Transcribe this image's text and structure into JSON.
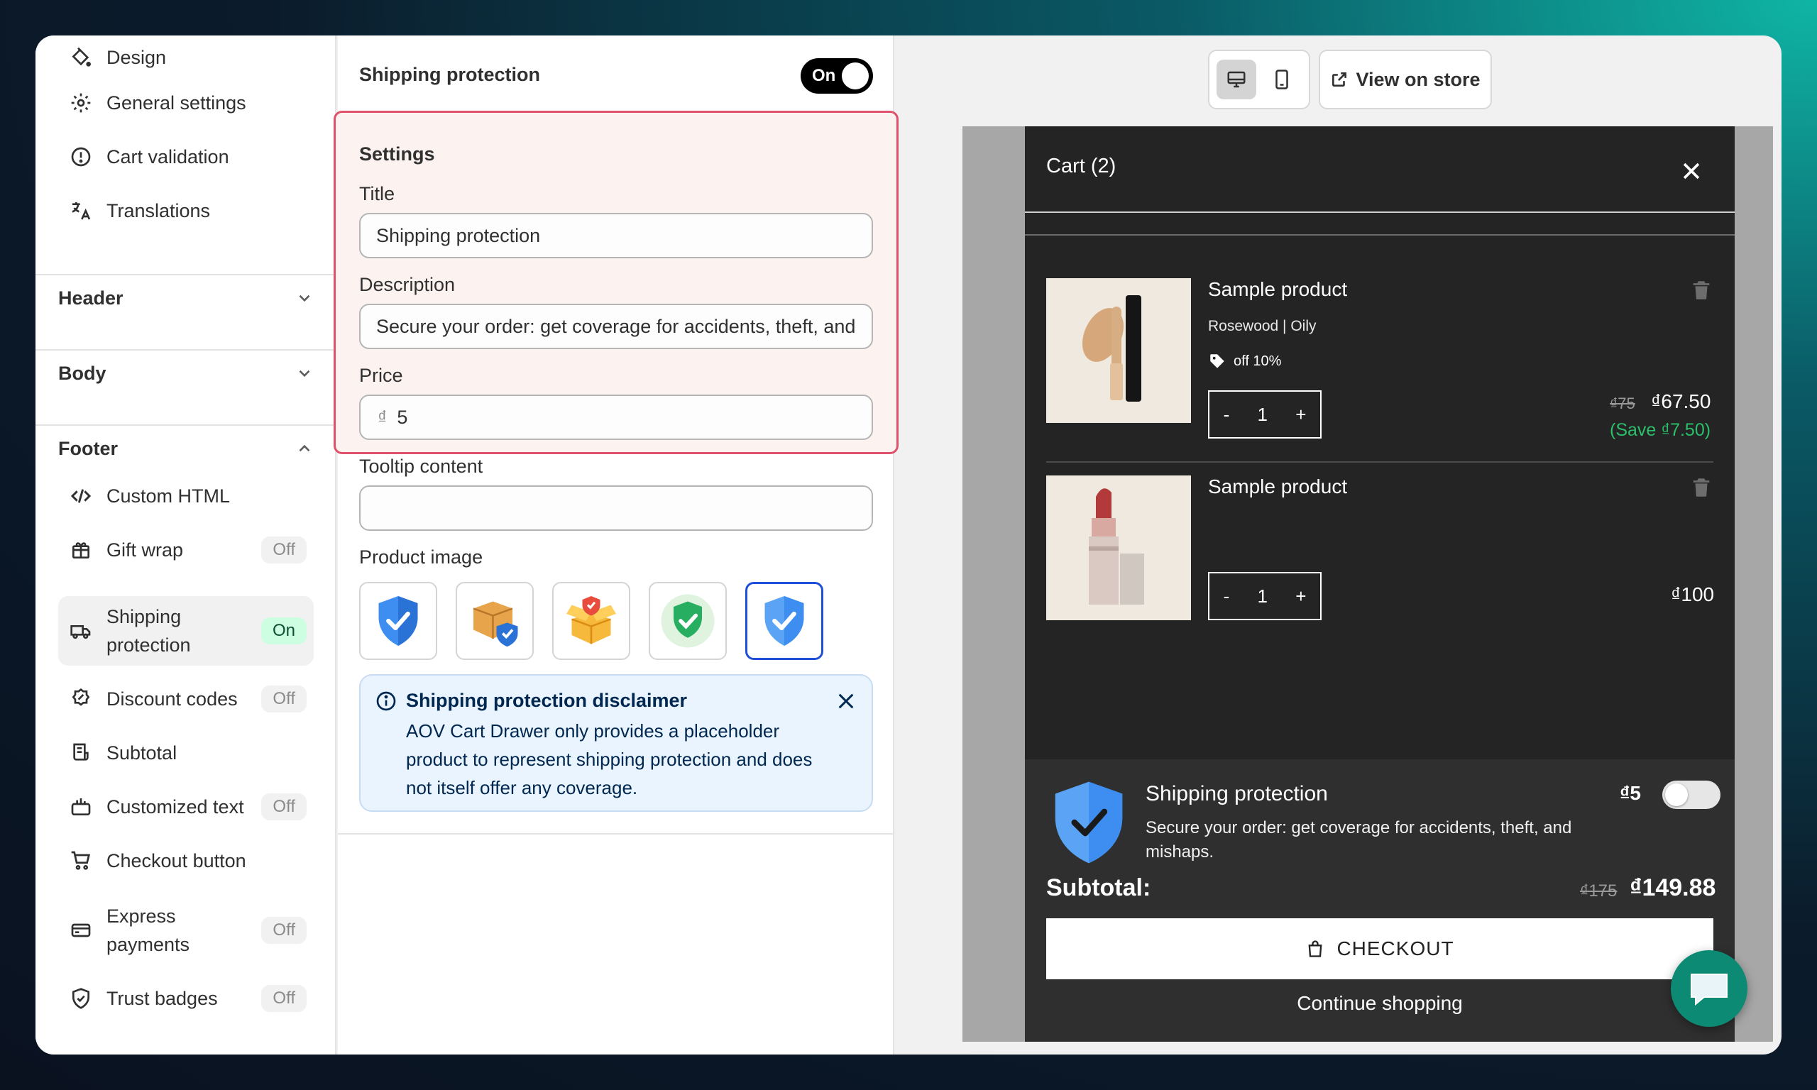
{
  "sidebar": {
    "top_items": [
      {
        "label": "Design",
        "icon": "paint-bucket-icon"
      },
      {
        "label": "General settings",
        "icon": "gear-icon"
      },
      {
        "label": "Cart validation",
        "icon": "alert-circle-icon"
      },
      {
        "label": "Translations",
        "icon": "translate-icon"
      }
    ],
    "sections": {
      "header": "Header",
      "body": "Body",
      "footer": "Footer"
    },
    "footer_items": [
      {
        "label": "Custom HTML",
        "icon": "code-icon",
        "badge": ""
      },
      {
        "label": "Gift wrap",
        "icon": "gift-icon",
        "badge": "Off"
      },
      {
        "label": "Shipping protection",
        "icon": "truck-icon",
        "badge": "On"
      },
      {
        "label": "Discount codes",
        "icon": "discount-icon",
        "badge": "Off"
      },
      {
        "label": "Subtotal",
        "icon": "receipt-icon",
        "badge": ""
      },
      {
        "label": "Customized text",
        "icon": "text-icon",
        "badge": "Off"
      },
      {
        "label": "Checkout button",
        "icon": "cart-icon",
        "badge": ""
      },
      {
        "label": "Express payments",
        "icon": "credit-card-icon",
        "badge": "Off"
      },
      {
        "label": "Trust badges",
        "icon": "shield-check-icon",
        "badge": "Off"
      }
    ]
  },
  "settings": {
    "heading": "Shipping protection",
    "toggle_label": "On",
    "section_label": "Settings",
    "title_label": "Title",
    "title_value": "Shipping protection",
    "description_label": "Description",
    "description_value": "Secure your order: get coverage for accidents, theft, and mishaps.",
    "price_label": "Price",
    "price_currency": "₫",
    "price_value": "5",
    "tooltip_label": "Tooltip content",
    "tooltip_value": "",
    "product_image_label": "Product image",
    "disclaimer_title": "Shipping protection disclaimer",
    "disclaimer_body": "AOV Cart Drawer only provides a placeholder product to represent shipping protection and does not itself offer any coverage."
  },
  "preview": {
    "view_store": "View on store",
    "cart_title": "Cart (2)",
    "items": [
      {
        "name": "Sample product",
        "variant": "Rosewood | Oily",
        "discount": "off 10%",
        "qty": "1",
        "old_price": "₫75",
        "price": "₫67.50",
        "save": "(Save ₫7.50)"
      },
      {
        "name": "Sample product",
        "qty": "1",
        "price": "₫100"
      }
    ],
    "qty_minus": "-",
    "qty_plus": "+",
    "protection_title": "Shipping protection",
    "protection_desc": "Secure your order: get coverage for accidents, theft, and mishaps.",
    "protection_price": "₫5",
    "subtotal_label": "Subtotal:",
    "subtotal_old": "₫175",
    "subtotal_value": "₫149.88",
    "checkout_label": "CHECKOUT",
    "continue_label": "Continue shopping"
  },
  "colors": {
    "accent_selected": "#1f4fd8",
    "highlight_border": "#e0526b",
    "save_green": "#2bbf6a",
    "chat_bubble": "#0c8a74"
  }
}
